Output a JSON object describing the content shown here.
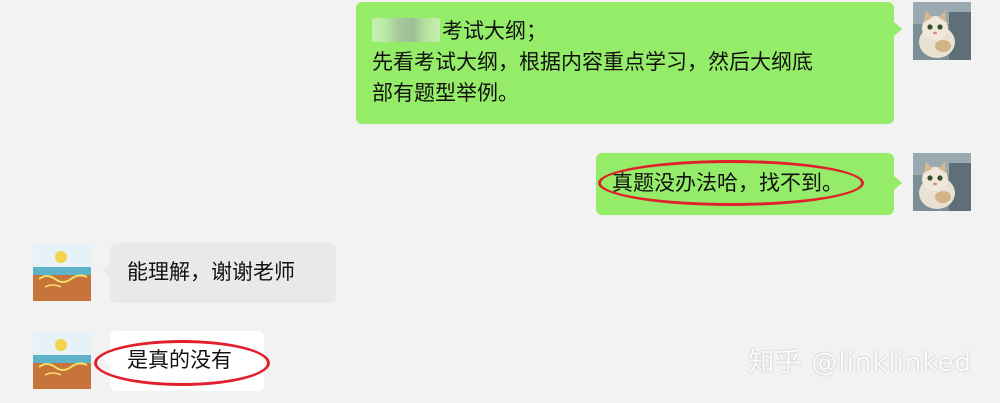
{
  "messages": [
    {
      "side": "right",
      "lines": [
        "考试大纲；",
        "先看考试大纲，根据内容重点学习，然后大纲底",
        "部有题型举例。"
      ],
      "has_redaction": true
    },
    {
      "side": "right",
      "text": "真题没办法哈，找不到。",
      "circled": true
    },
    {
      "side": "left",
      "text": "能理解，谢谢老师"
    },
    {
      "side": "left",
      "text": "是真的没有",
      "circled": true
    }
  ],
  "avatars": {
    "right": "cat-photo-avatar",
    "left": "summer-beach-avatar"
  },
  "watermark": "知乎 @linklinked",
  "colors": {
    "background": "#f2f2f2",
    "sent_bubble": "#95ec69",
    "received_bubble_white": "#ffffff",
    "received_bubble_gray": "#e9e9e9",
    "annotation_circle": "#e0202a"
  }
}
